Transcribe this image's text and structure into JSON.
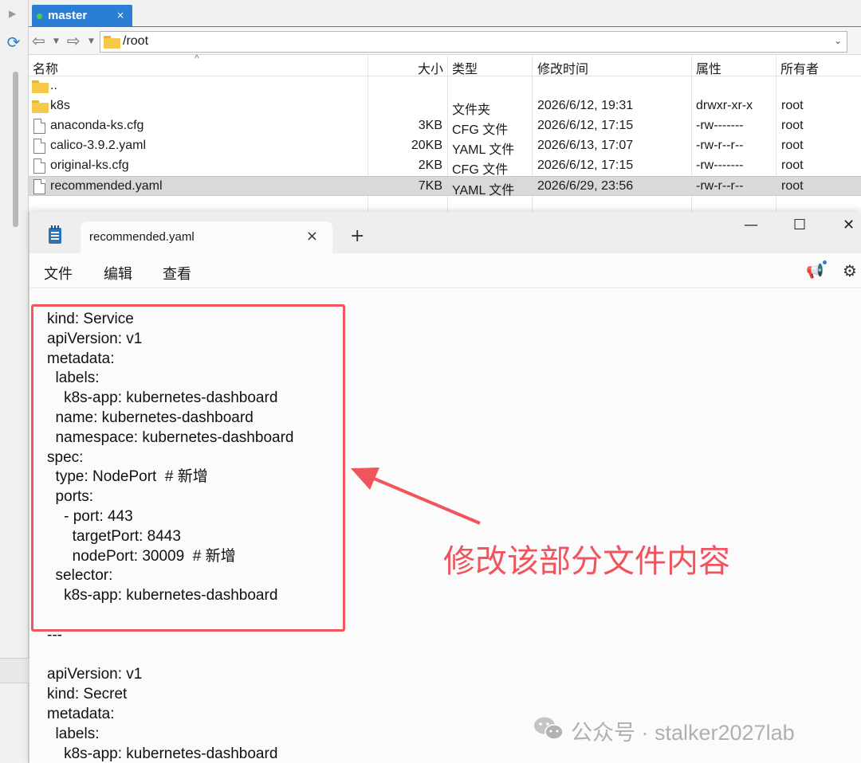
{
  "file_manager": {
    "tab": {
      "label": "master",
      "close": "×"
    },
    "path": "/root",
    "columns": [
      "名称",
      "大小",
      "类型",
      "修改时间",
      "属性",
      "所有者"
    ],
    "files": [
      {
        "name": "..",
        "size": "",
        "type": "",
        "modified": "",
        "attrs": "",
        "owner": "",
        "icon": "folder-icon"
      },
      {
        "name": "k8s",
        "size": "",
        "type": "文件夹",
        "modified": "2026/6/12, 19:31",
        "attrs": "drwxr-xr-x",
        "owner": "root",
        "icon": "folder-icon"
      },
      {
        "name": "anaconda-ks.cfg",
        "size": "3KB",
        "type": "CFG 文件",
        "modified": "2026/6/12, 17:15",
        "attrs": "-rw-------",
        "owner": "root",
        "icon": "file-icon"
      },
      {
        "name": "calico-3.9.2.yaml",
        "size": "20KB",
        "type": "YAML 文件",
        "modified": "2026/6/13, 17:07",
        "attrs": "-rw-r--r--",
        "owner": "root",
        "icon": "file-icon"
      },
      {
        "name": "original-ks.cfg",
        "size": "2KB",
        "type": "CFG 文件",
        "modified": "2026/6/12, 17:15",
        "attrs": "-rw-------",
        "owner": "root",
        "icon": "file-icon"
      },
      {
        "name": "recommended.yaml",
        "size": "7KB",
        "type": "YAML 文件",
        "modified": "2026/6/29, 23:56",
        "attrs": "-rw-r--r--",
        "owner": "root",
        "icon": "file-icon",
        "selected": true
      }
    ]
  },
  "notepad": {
    "tab_title": "recommended.yaml",
    "tab_close": "×",
    "new_tab": "+",
    "window_controls": {
      "minimize": "—",
      "maximize": "☐",
      "close": "✕"
    },
    "menu": [
      "文件",
      "编辑",
      "查看"
    ],
    "content_lines": [
      "kind: Service",
      "apiVersion: v1",
      "metadata:",
      "  labels:",
      "    k8s-app: kubernetes-dashboard",
      "  name: kubernetes-dashboard",
      "  namespace: kubernetes-dashboard",
      "spec:",
      "  type: NodePort  # 新增",
      "  ports:",
      "    - port: 443",
      "      targetPort: 8443",
      "      nodePort: 30009  # 新增",
      "  selector:",
      "    k8s-app: kubernetes-dashboard",
      "",
      "---",
      "",
      "apiVersion: v1",
      "kind: Secret",
      "metadata:",
      "  labels:",
      "    k8s-app: kubernetes-dashboard"
    ]
  },
  "annotation": {
    "text": "修改该部分文件内容",
    "color": "#f0545c"
  },
  "watermark": {
    "text": "公众号 · stalker2027lab",
    "icon": "wechat-icon"
  },
  "colors": {
    "accent": "#2a7fd4",
    "folder": "#f7c948",
    "selected_row": "#d9d9d9",
    "annotation": "#f0545c"
  }
}
